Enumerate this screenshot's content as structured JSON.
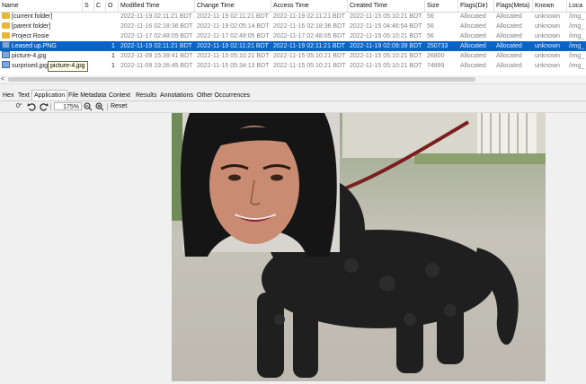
{
  "table": {
    "columns": [
      "Name",
      "S",
      "C",
      "O",
      "Modified Time",
      "Change Time",
      "Access Time",
      "Created Time",
      "Size",
      "Flags(Dir)",
      "Flags(Meta)",
      "Known",
      "Loca"
    ],
    "rows": [
      {
        "icon": "folder-icon",
        "name": "[current folder]",
        "o": "",
        "modified": "2022-11-19 02:11:21 BDT",
        "change": "2022-11-19 02:11:21 BDT",
        "access": "2022-11-19 02:11:21 BDT",
        "created": "2022-11-15 05:10:21 BDT",
        "size": "56",
        "flags_dir": "Allocated",
        "flags_meta": "Allocated",
        "known": "unknown",
        "location": "/img_"
      },
      {
        "icon": "folder-icon",
        "name": "[parent folder]",
        "o": "",
        "modified": "2022-11-16 02:18:36 BDT",
        "change": "2022-11-19 02:05:14 BDT",
        "access": "2022-11-16 02:18:36 BDT",
        "created": "2022-11-15 04:46:54 BDT",
        "size": "56",
        "flags_dir": "Allocated",
        "flags_meta": "Allocated",
        "known": "unknown",
        "location": "/img_"
      },
      {
        "icon": "folder-icon",
        "name": "Project Rosie",
        "o": "",
        "modified": "2022-11-17 02:48:05 BDT",
        "change": "2022-11-17 02:48:05 BDT",
        "access": "2022-11-17 02:48:05 BDT",
        "created": "2022-11-15 05:10:21 BDT",
        "size": "56",
        "flags_dir": "Allocated",
        "flags_meta": "Allocated",
        "known": "unknown",
        "location": "/img_"
      },
      {
        "icon": "image-file-icon",
        "name": "Leased up.PNG",
        "o": "1",
        "modified": "2022-11-19 02:11:21 BDT",
        "change": "2022-11-19 02:11:21 BDT",
        "access": "2022-11-19 02:11:21 BDT",
        "created": "2022-11-19 02:09:39 BDT",
        "size": "250733",
        "flags_dir": "Allocated",
        "flags_meta": "Allocated",
        "known": "unknown",
        "location": "/img_",
        "selected": true
      },
      {
        "icon": "image-file-icon",
        "name": "picture-4.jpg",
        "o": "1",
        "modified": "2022-11-09 15:39:41 BDT",
        "change": "2022-11-15 05:10:21 BDT",
        "access": "2022-11-15 05:10:21 BDT",
        "created": "2022-11-15 05:10:21 BDT",
        "size": "26800",
        "flags_dir": "Allocated",
        "flags_meta": "Allocated",
        "known": "unknown",
        "location": "/img_"
      },
      {
        "icon": "image-file-icon",
        "name": "surprised.jpg",
        "o": "1",
        "modified": "2022-11-09 19:26:45 BDT",
        "change": "2022-11-15 05:34:13 BDT",
        "access": "2022-11-15 05:10:21 BDT",
        "created": "2022-11-15 05:10:21 BDT",
        "size": "74899",
        "flags_dir": "Allocated",
        "flags_meta": "Allocated",
        "known": "unknown",
        "location": "/img_"
      }
    ],
    "tooltip": "picture-4.jpg"
  },
  "scroll": {
    "left_arrow": "<"
  },
  "tabs": [
    "Hex",
    "Text",
    "Application",
    "File Metadata",
    "Context",
    "Results",
    "Annotations",
    "Other Occurrences"
  ],
  "active_tab": "Application",
  "toolbar": {
    "rotation": "0°",
    "zoom": "175%",
    "reset": "Reset"
  },
  "colors": {
    "selection": "#0a64c8",
    "folder": "#e8b63a"
  }
}
